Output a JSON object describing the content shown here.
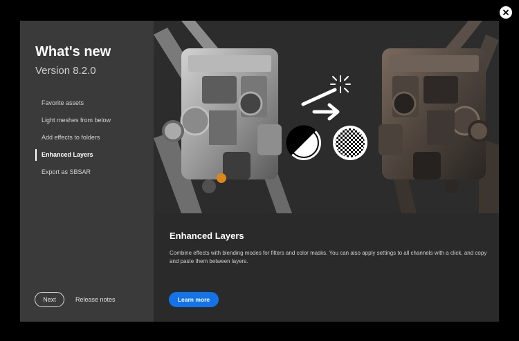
{
  "window": {
    "close_icon": "close-icon"
  },
  "sidebar": {
    "title": "What's new",
    "version": "Version 8.2.0",
    "items": [
      {
        "label": "Favorite assets",
        "active": false
      },
      {
        "label": "Light meshes from below",
        "active": false
      },
      {
        "label": "Add effects to folders",
        "active": false
      },
      {
        "label": "Enhanced Layers",
        "active": true
      },
      {
        "label": "Export as SBSAR",
        "active": false
      }
    ],
    "next_label": "Next",
    "release_notes_label": "Release notes"
  },
  "hero": {
    "left_robot": "clean-robot",
    "right_robot": "rusted-robot",
    "icons": [
      "magic-wand-icon",
      "arrow-right-icon",
      "contrast-circle-icon",
      "checkerboard-circle-icon"
    ]
  },
  "content": {
    "title": "Enhanced Layers",
    "description": "Combine effects with blending modes for filters and color masks. You can also apply settings to all channels with a click, and copy and paste them between layers.",
    "learn_more_label": "Learn more"
  },
  "colors": {
    "background": "#000000",
    "dialog": "#2a2a2a",
    "sidebar": "#3a3a3a",
    "accent": "#1473e6",
    "text": "#ffffff"
  }
}
